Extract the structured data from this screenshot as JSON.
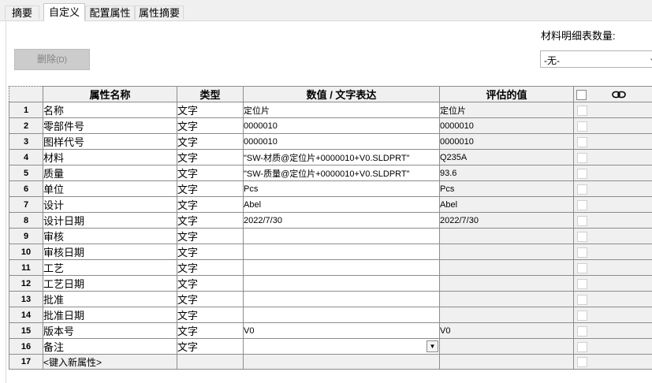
{
  "tabs": [
    {
      "label": "摘要"
    },
    {
      "label": "自定义"
    },
    {
      "label": "配置属性"
    },
    {
      "label": "属性摘要"
    }
  ],
  "active_tab": "自定义",
  "delete_button": {
    "label": "删除",
    "accel": "(D)"
  },
  "bom_quantity": {
    "label": "材料明细表数量:",
    "value": "-无-"
  },
  "table": {
    "headers": {
      "name": "属性名称",
      "type": "类型",
      "value": "数值 / 文字表达",
      "evaluated": "评估的值"
    },
    "rows": [
      {
        "num": "1",
        "name": "名称",
        "type": "文字",
        "value": "定位片",
        "evaluated": "定位片"
      },
      {
        "num": "2",
        "name": "零部件号",
        "type": "文字",
        "value": "0000010",
        "evaluated": "0000010"
      },
      {
        "num": "3",
        "name": "图样代号",
        "type": "文字",
        "value": "0000010",
        "evaluated": "0000010"
      },
      {
        "num": "4",
        "name": "材料",
        "type": "文字",
        "value": "\"SW-材质@定位片+0000010+V0.SLDPRT\"",
        "evaluated": "Q235A"
      },
      {
        "num": "5",
        "name": "质量",
        "type": "文字",
        "value": "\"SW-质量@定位片+0000010+V0.SLDPRT\"",
        "evaluated": "93.6"
      },
      {
        "num": "6",
        "name": "单位",
        "type": "文字",
        "value": "Pcs",
        "evaluated": "Pcs"
      },
      {
        "num": "7",
        "name": "设计",
        "type": "文字",
        "value": "Abel",
        "evaluated": "Abel"
      },
      {
        "num": "8",
        "name": "设计日期",
        "type": "文字",
        "value": "2022/7/30",
        "evaluated": "2022/7/30"
      },
      {
        "num": "9",
        "name": "审核",
        "type": "文字",
        "value": "",
        "evaluated": ""
      },
      {
        "num": "10",
        "name": "审核日期",
        "type": "文字",
        "value": "",
        "evaluated": ""
      },
      {
        "num": "11",
        "name": "工艺",
        "type": "文字",
        "value": "",
        "evaluated": ""
      },
      {
        "num": "12",
        "name": "工艺日期",
        "type": "文字",
        "value": "",
        "evaluated": ""
      },
      {
        "num": "13",
        "name": "批准",
        "type": "文字",
        "value": "",
        "evaluated": ""
      },
      {
        "num": "14",
        "name": "批准日期",
        "type": "文字",
        "value": "",
        "evaluated": ""
      },
      {
        "num": "15",
        "name": "版本号",
        "type": "文字",
        "value": "V0",
        "evaluated": "V0"
      },
      {
        "num": "16",
        "name": "备注",
        "type": "文字",
        "value": "",
        "evaluated": ""
      },
      {
        "num": "17",
        "name": "<键入新属性>",
        "type": "",
        "value": "",
        "evaluated": ""
      }
    ]
  }
}
